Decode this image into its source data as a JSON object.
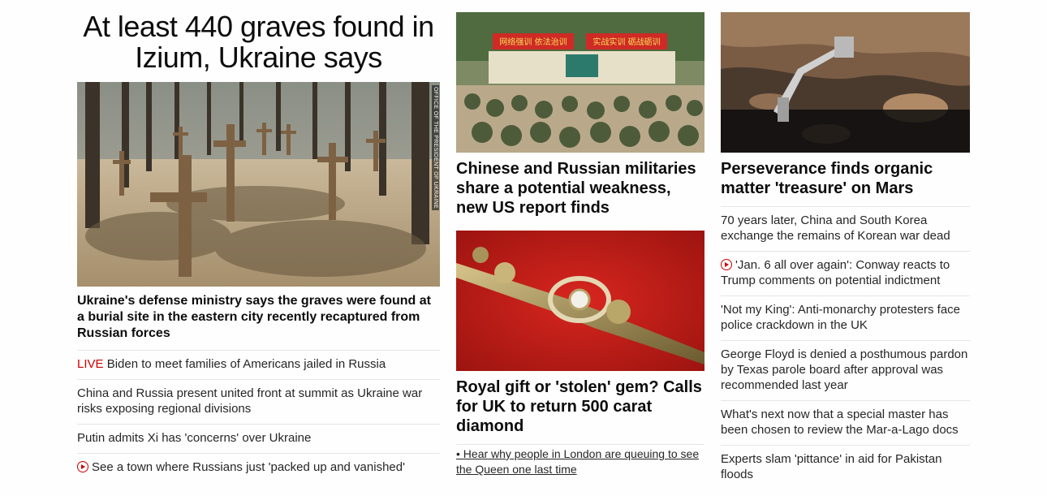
{
  "hero": {
    "title": "At least 440 graves found in Izium, Ukraine says",
    "image_credit": "OFFICE OF THE PRESIDENT OF UKRAINE",
    "description": "Ukraine's defense ministry says the graves were found at a burial site in the eastern city recently recaptured from Russian forces",
    "related": [
      {
        "prefix": "LIVE",
        "text": "Biden to meet families of Americans jailed in Russia",
        "icon": "none"
      },
      {
        "prefix": "",
        "text": "China and Russia present united front at summit as Ukraine war risks exposing regional divisions",
        "icon": "none"
      },
      {
        "prefix": "",
        "text": "Putin admits Xi has 'concerns' over Ukraine",
        "icon": "none"
      },
      {
        "prefix": "",
        "text": "See a town where Russians just 'packed up and vanished'",
        "icon": "play-icon"
      }
    ]
  },
  "middle": {
    "story1": {
      "title": "Chinese and Russian militaries share a potential weakness, new US report finds",
      "banner_left": "网络强训 依法治训",
      "banner_right": "实战实训 砺战砺训"
    },
    "story2": {
      "title": "Royal gift or 'stolen' gem? Calls for UK to return 500 carat diamond",
      "sub_link": "• Hear why people in London are queuing to see the Queen one last time"
    }
  },
  "right": {
    "lead_title": "Perseverance finds organic matter 'treasure' on Mars",
    "list": [
      {
        "text": "70 years later, China and South Korea exchange the remains of Korean war dead",
        "icon": "none"
      },
      {
        "text": "'Jan. 6 all over again': Conway reacts to Trump comments on potential indictment",
        "icon": "play-icon"
      },
      {
        "text": "'Not my King': Anti-monarchy protesters face police crackdown in the UK",
        "icon": "none"
      },
      {
        "text": "George Floyd is denied a posthumous pardon by Texas parole board after approval was recommended last year",
        "icon": "none"
      },
      {
        "text": "What's next now that a special master has been chosen to review the Mar-a-Lago docs",
        "icon": "none"
      },
      {
        "text": "Experts slam 'pittance' in aid for Pakistan floods",
        "icon": "none"
      }
    ]
  },
  "colors": {
    "live": "#cc0000",
    "text": "#0c0c0c",
    "divider": "#e6e6e6"
  }
}
